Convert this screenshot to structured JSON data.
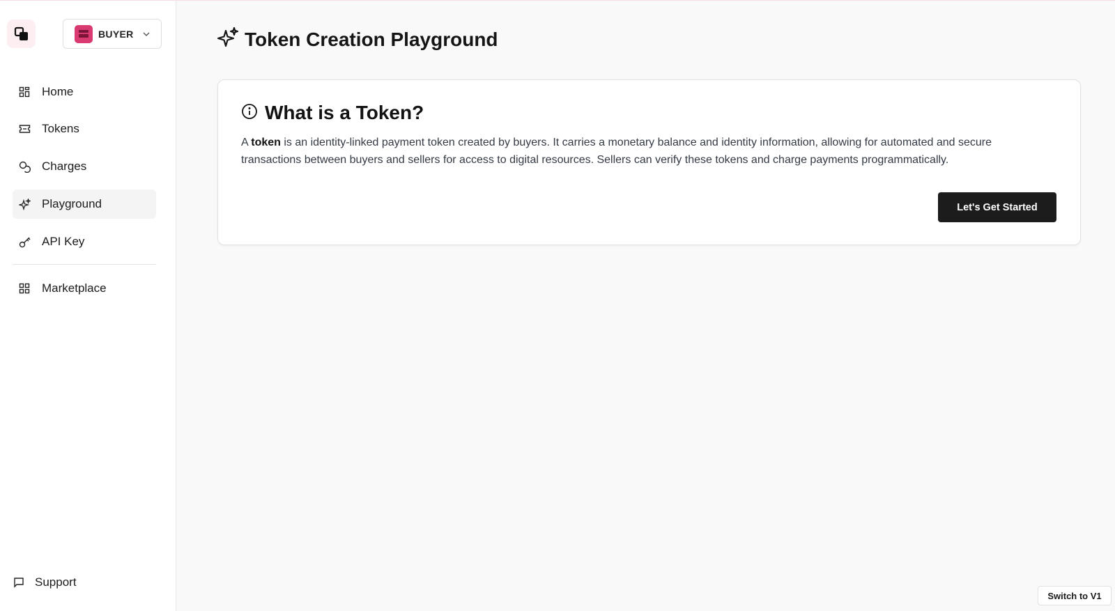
{
  "sidebar": {
    "role": {
      "label": "BUYER",
      "avatar_color": "#d93a72"
    },
    "nav": [
      {
        "label": "Home",
        "icon": "grid-icon"
      },
      {
        "label": "Tokens",
        "icon": "ticket-icon"
      },
      {
        "label": "Charges",
        "icon": "coins-icon"
      },
      {
        "label": "Playground",
        "icon": "sparkles-icon",
        "active": true
      },
      {
        "label": "API Key",
        "icon": "key-icon"
      },
      {
        "label": "Marketplace",
        "icon": "grid-icon"
      }
    ],
    "support_label": "Support"
  },
  "page": {
    "title": "Token Creation Playground"
  },
  "card": {
    "title": "What is a Token?",
    "body_prefix": "A ",
    "body_bold": "token",
    "body_rest": " is an identity-linked payment token created by buyers. It carries a monetary balance and identity information, allowing for automated and secure transactions between buyers and sellers for access to digital resources. Sellers can verify these tokens and charge payments programmatically.",
    "cta_label": "Let's Get Started"
  },
  "footer": {
    "switch_label": "Switch to V1"
  },
  "colors": {
    "accent": "#1c1c1c",
    "brand": "#d93a72"
  }
}
